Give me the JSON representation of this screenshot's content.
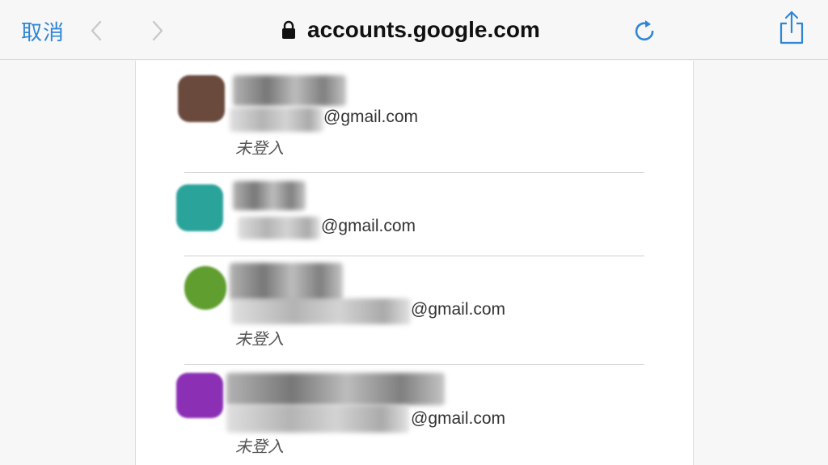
{
  "toolbar": {
    "cancel_label": "取消",
    "back_icon": "chevron-left-icon",
    "forward_icon": "chevron-right-icon",
    "secure_icon": "lock-icon",
    "host": "accounts.google.com",
    "reload_icon": "reload-icon",
    "share_icon": "share-icon"
  },
  "accounts": [
    {
      "avatar_color": "#6b4a3e",
      "email_domain": "@gmail.com",
      "status": "未登入"
    },
    {
      "avatar_color": "#2aa39a",
      "email_domain": "@gmail.com",
      "status": ""
    },
    {
      "avatar_color": "#5f9e2f",
      "email_domain": "@gmail.com",
      "status": "未登入"
    },
    {
      "avatar_color": "#8b2fb5",
      "email_domain": "@gmail.com",
      "status": "未登入"
    }
  ],
  "colors": {
    "accent": "#2f86d6"
  }
}
